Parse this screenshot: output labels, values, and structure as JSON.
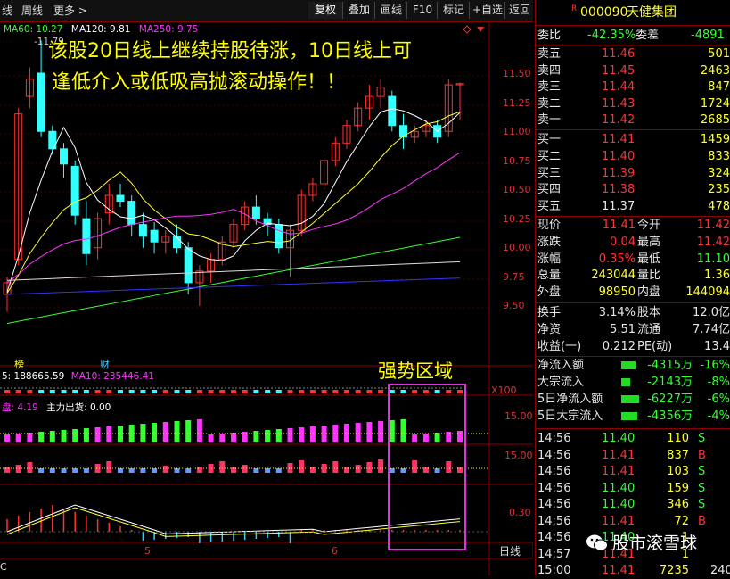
{
  "toolbar": {
    "left_items": [
      "线",
      "周线",
      "更多 >"
    ],
    "buttons": [
      "复权",
      "叠加",
      "画线",
      "F10",
      "标记",
      "+自选",
      "返回"
    ]
  },
  "ma": {
    "ma60": "MA60: 10.27",
    "ma120": "MA120: 9.81",
    "ma250": "MA250: 9.75",
    "peak": "-11.79",
    "colors": {
      "ma60": "#33ff33",
      "ma120": "#ffffff",
      "ma250": "#ff33ff"
    }
  },
  "annotation": {
    "line1": "该股20日线上继续持股待涨，10日线上可",
    "line2": "逢低介入或低吸高抛滚动操作！！",
    "zone": "强势区域"
  },
  "price_axis": [
    "11.50",
    "11.25",
    "11.00",
    "10.75",
    "10.50",
    "10.25",
    "10.00",
    "9.75",
    "9.50"
  ],
  "volume": {
    "label": "5: 188665.59",
    "ma10": "MA10: 235446.41",
    "multiplier": "X100",
    "tag1": "榜",
    "tag2": "财"
  },
  "fund": {
    "label": "盘: 4.19",
    "label2": "主力出货: 0.00",
    "axis1": "15.00",
    "axis2": "15.00",
    "axis3": "0.30"
  },
  "xaxis": {
    "m5": "5",
    "m6": "6",
    "period": "日线",
    "c": "C"
  },
  "stock": {
    "code": "000090",
    "name": "天健集团",
    "badge": "R"
  },
  "ratio": {
    "k1": "委比",
    "v1": "-42.35%",
    "k2": "委差",
    "v2": "-4891"
  },
  "asks": [
    {
      "label": "卖五",
      "price": "11.46",
      "vol": "501"
    },
    {
      "label": "卖四",
      "price": "11.45",
      "vol": "2463"
    },
    {
      "label": "卖三",
      "price": "11.44",
      "vol": "847"
    },
    {
      "label": "卖二",
      "price": "11.43",
      "vol": "1724"
    },
    {
      "label": "卖一",
      "price": "11.42",
      "vol": "2685"
    }
  ],
  "bids": [
    {
      "label": "买一",
      "price": "11.41",
      "vol": "1459"
    },
    {
      "label": "买二",
      "price": "11.40",
      "vol": "833"
    },
    {
      "label": "买三",
      "price": "11.39",
      "vol": "324"
    },
    {
      "label": "买四",
      "price": "11.38",
      "vol": "235"
    },
    {
      "label": "买五",
      "price": "11.37",
      "vol": "478"
    }
  ],
  "quote": [
    {
      "k1": "现价",
      "v1": "11.41",
      "k2": "今开",
      "v2": "11.42"
    },
    {
      "k1": "涨跌",
      "v1": "0.04",
      "k2": "最高",
      "v2": "11.42"
    },
    {
      "k1": "涨幅",
      "v1": "0.35%",
      "k2": "最低",
      "v2": "11.10"
    },
    {
      "k1": "总量",
      "v1": "243044",
      "k2": "量比",
      "v2": "1.36"
    },
    {
      "k1": "外盘",
      "v1": "98950",
      "k2": "内盘",
      "v2": "144094"
    }
  ],
  "fin": [
    {
      "k1": "换手",
      "v1": "3.14%",
      "k2": "股本",
      "v2": "12.0亿"
    },
    {
      "k1": "净资",
      "v1": "5.51",
      "k2": "流通",
      "v2": "7.74亿"
    },
    {
      "k1": "收益(一)",
      "v1": "0.212",
      "k2": "PE(动)",
      "v2": "13.4"
    }
  ],
  "flows": [
    {
      "k": "净流入额",
      "v": "-4315万",
      "p": "-16%"
    },
    {
      "k": "大宗流入",
      "v": "-2143万",
      "p": "-8%"
    },
    {
      "k": "5日净流入额",
      "v": "-6227万",
      "p": "-6%"
    },
    {
      "k": "5日大宗流入",
      "v": "-4356万",
      "p": "-4%"
    }
  ],
  "ticks": [
    {
      "t": "14:56",
      "p": "11.40",
      "v": "110",
      "s": "S"
    },
    {
      "t": "14:56",
      "p": "11.41",
      "v": "837",
      "s": "B"
    },
    {
      "t": "14:56",
      "p": "11.41",
      "v": "103",
      "s": "S"
    },
    {
      "t": "14:56",
      "p": "11.40",
      "v": "159",
      "s": "S"
    },
    {
      "t": "14:56",
      "p": "11.40",
      "v": "346",
      "s": "S"
    },
    {
      "t": "14:56",
      "p": "11.41",
      "v": "72",
      "s": "B"
    },
    {
      "t": "14:56",
      "p": "11.40",
      "v": "1",
      "s": ""
    },
    {
      "t": "14:57",
      "p": "11.41",
      "v": "1",
      "s": ""
    },
    {
      "t": "15:00",
      "p": "11.41",
      "v": "7235",
      "s": ""
    }
  ],
  "last_tick_extra": "240",
  "watermark": "股市滚雪球"
}
